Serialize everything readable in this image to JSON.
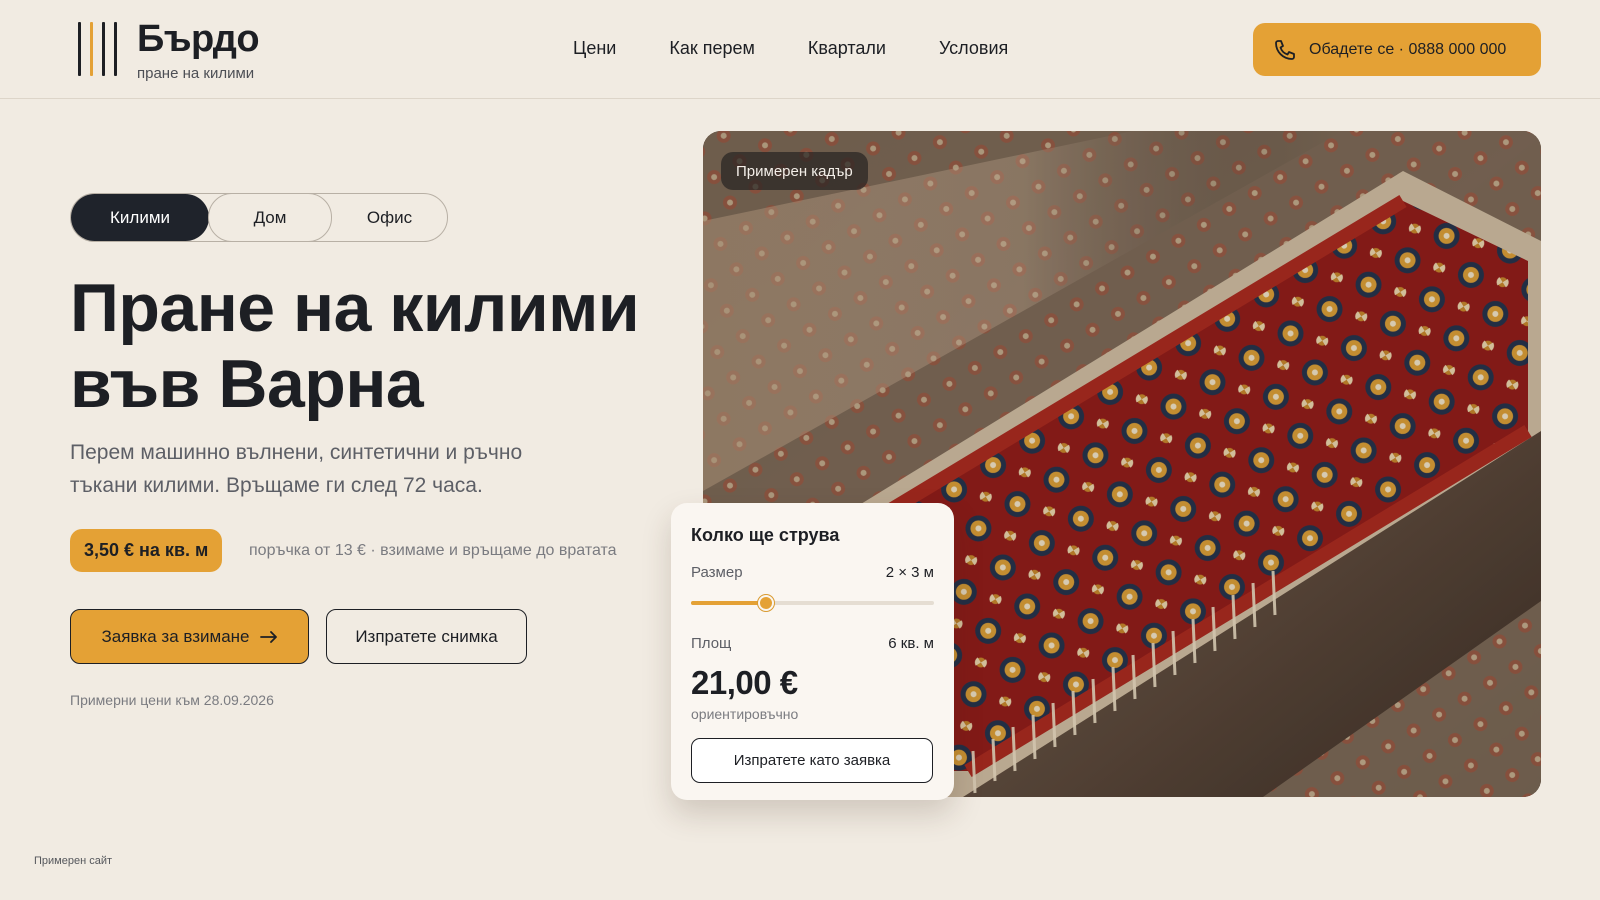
{
  "brand": {
    "name": "Бърдо",
    "tagline": "пране на килими"
  },
  "nav": {
    "items": [
      "Цени",
      "Как перем",
      "Квартали",
      "Условия"
    ]
  },
  "header": {
    "call_label": "Обадете се · 0888 000 000"
  },
  "tabs": [
    {
      "label": "Килими",
      "active": true
    },
    {
      "label": "Дом",
      "active": false
    },
    {
      "label": "Офис",
      "active": false
    }
  ],
  "hero": {
    "title_line1": "Пране на килими",
    "title_line2": "във Варна",
    "description": "Перем машинно вълнени, синтетични и ръчно тъкани килими. Връщаме ги след 72 часа.",
    "price_badge": "3,50 € на кв. м",
    "price_note": "поръчка от 13 € · взимаме и връщаме до вратата",
    "primary_button": "Заявка за взимане",
    "secondary_button": "Изпратете снимка",
    "date_note": "Примерни цени към 28.09.2026"
  },
  "photo": {
    "badge": "Примерен кадър"
  },
  "calculator": {
    "title": "Колко ще струва",
    "size_label": "Размер",
    "size_value": "2 × 3 м",
    "slider_fraction": 0.31,
    "area_label": "Площ",
    "area_value": "6 кв. м",
    "total": "21,00 €",
    "total_note": "ориентировъчно",
    "submit_button": "Изпратете като заявка"
  },
  "footer": {
    "note": "Примерен сайт"
  },
  "colors": {
    "accent": "#e4a135",
    "dark": "#1f232b",
    "background": "#f1ebe2"
  }
}
